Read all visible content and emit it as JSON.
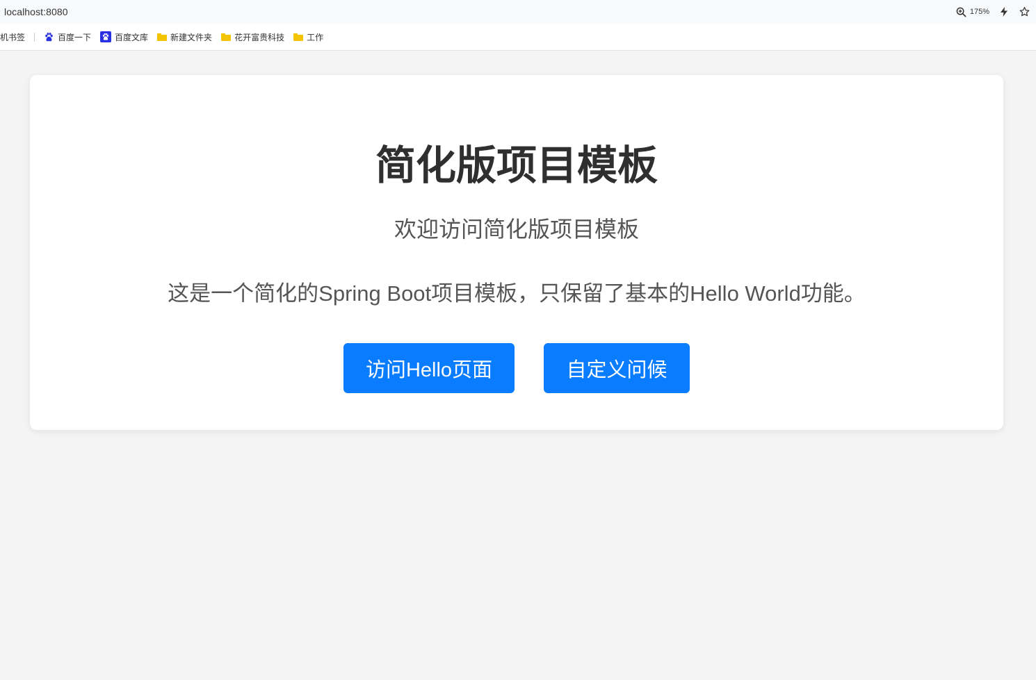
{
  "browser": {
    "url": "localhost:8080",
    "zoom": "175%",
    "icons": [
      "zoom-icon",
      "lightning-icon",
      "star-icon"
    ]
  },
  "bookmarks": {
    "items": [
      {
        "label": "机书签",
        "icon": "none"
      },
      {
        "label": "百度一下",
        "icon": "baidu-paw-icon"
      },
      {
        "label": "百度文库",
        "icon": "wenku-icon"
      },
      {
        "label": "新建文件夹",
        "icon": "folder-icon"
      },
      {
        "label": "花开富贵科技",
        "icon": "folder-icon"
      },
      {
        "label": "工作",
        "icon": "folder-icon"
      }
    ]
  },
  "page": {
    "title": "简化版项目模板",
    "subtitle": "欢迎访问简化版项目模板",
    "description": "这是一个简化的Spring Boot项目模板，只保留了基本的Hello World功能。",
    "buttons": {
      "hello": "访问Hello页面",
      "greet": "自定义问候"
    }
  },
  "colors": {
    "accent": "#0a7cff",
    "background": "#f4f4f4",
    "card": "#ffffff",
    "folder": "#f5c400"
  }
}
